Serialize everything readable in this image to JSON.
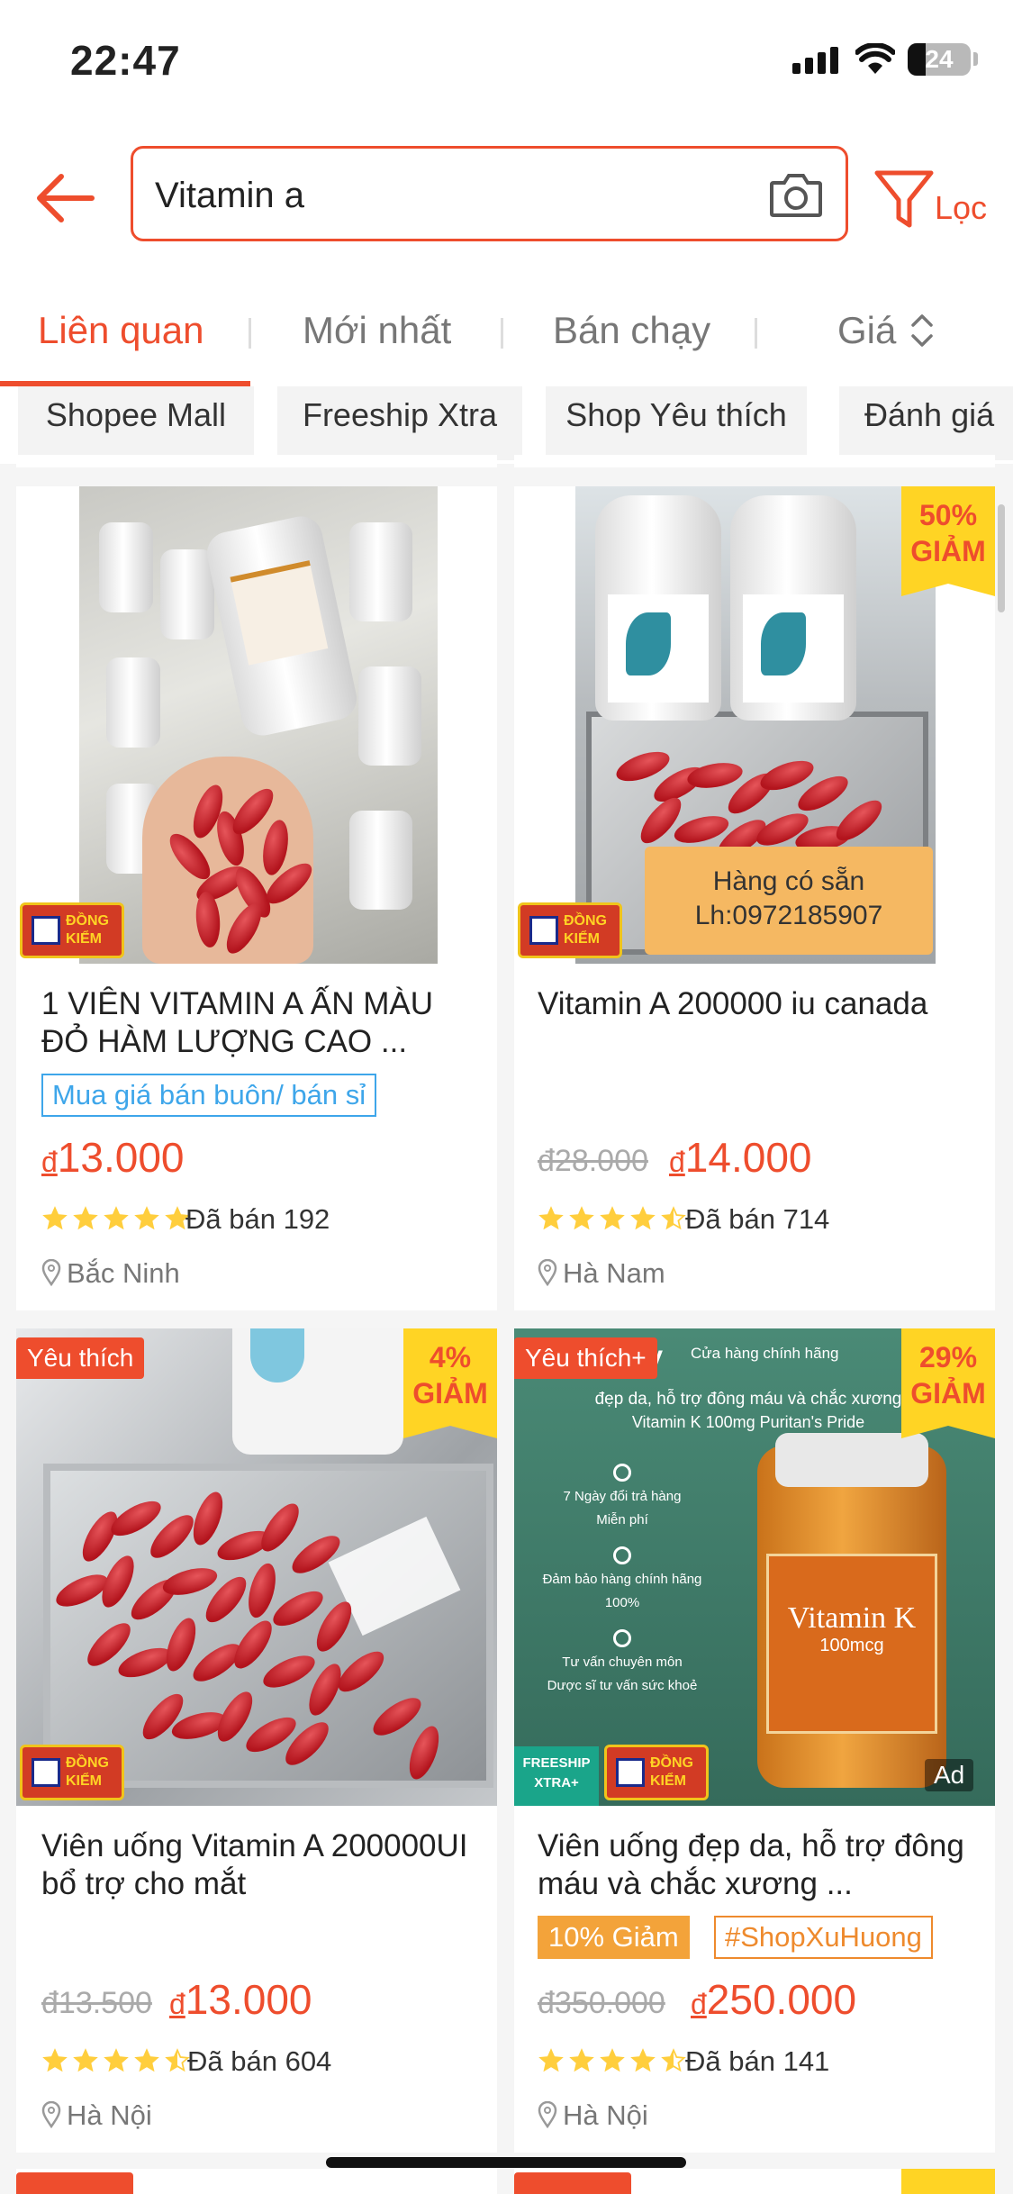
{
  "status_bar": {
    "time": "22:47",
    "battery": "24"
  },
  "search": {
    "query": "Vitamin a",
    "filter_label": "Lọc"
  },
  "sort_tabs": [
    {
      "label": "Liên quan"
    },
    {
      "label": "Mới nhất"
    },
    {
      "label": "Bán chạy"
    },
    {
      "label": "Giá"
    }
  ],
  "filter_chips": [
    {
      "label": "Shopee Mall"
    },
    {
      "label": "Freeship Xtra"
    },
    {
      "label": "Shop Yêu thích"
    },
    {
      "label": "Đánh giá"
    }
  ],
  "badges": {
    "dong_kiem_line1": "ĐỒNG",
    "dong_kiem_line2": "KIỂM",
    "giam": "GIẢM",
    "freeship_line1": "FREESHIP",
    "freeship_line2": "XTRA+",
    "ad": "Ad"
  },
  "products": [
    {
      "title": "1 VIÊN VITAMIN A ẤN MÀU ĐỎ HÀM LƯỢNG CAO ...",
      "tag": "Mua giá bán buôn/ bán sỉ",
      "currency": "đ",
      "price": "13.000",
      "rating": 5,
      "sold": "Đã bán 192",
      "location": "Bắc Ninh"
    },
    {
      "title": "Vitamin A 200000 iu canada",
      "discount": "50%",
      "overlay_text_1": "Hàng có sẵn",
      "overlay_text_2": "Lh:0972185907",
      "old_price": "đ28.000",
      "currency": "đ",
      "price": "14.000",
      "rating": 4.5,
      "sold": "Đã bán 714",
      "location": "Hà Nam"
    },
    {
      "title": "Viên uống Vitamin A 200000UI bổ trợ cho mắt",
      "favorite": "Yêu thích",
      "discount": "4%",
      "old_price": "đ13.500",
      "currency": "đ",
      "price": "13.000",
      "rating": 4.5,
      "sold": "Đã bán 604",
      "location": "Hà Nội"
    },
    {
      "title": "Viên uống đẹp da, hỗ trợ đông máu và chắc xương ...",
      "favorite": "Yêu thích+",
      "discount": "29%",
      "promo_tag": "10% Giảm",
      "hashtag": "#ShopXuHuong",
      "old_price": "đ350.000",
      "currency": "đ",
      "price": "250.000",
      "rating": 4.5,
      "sold": "Đã bán 141",
      "location": "Hà Nội",
      "image_text": {
        "brand": "tadaily",
        "store": "Cửa hàng chính hãng",
        "headline": "đẹp da, hỗ trợ đông máu và chắc xương",
        "subhead": "Vitamin K 100mg Puritan's Pride",
        "b1": "7 Ngày đổi trả hàng",
        "b1s": "Miễn phí",
        "b2": "Đảm bảo hàng chính hãng",
        "b2s": "100%",
        "b3": "Tư vấn chuyên môn",
        "b3s": "Dược sĩ tư vấn sức khoẻ",
        "bottle_label": "Vitamin K",
        "bottle_dose": "100mcg"
      }
    }
  ],
  "colors": {
    "accent": "#ee4d2d",
    "discount_bg": "#ffd424",
    "star": "#ffce3d"
  }
}
